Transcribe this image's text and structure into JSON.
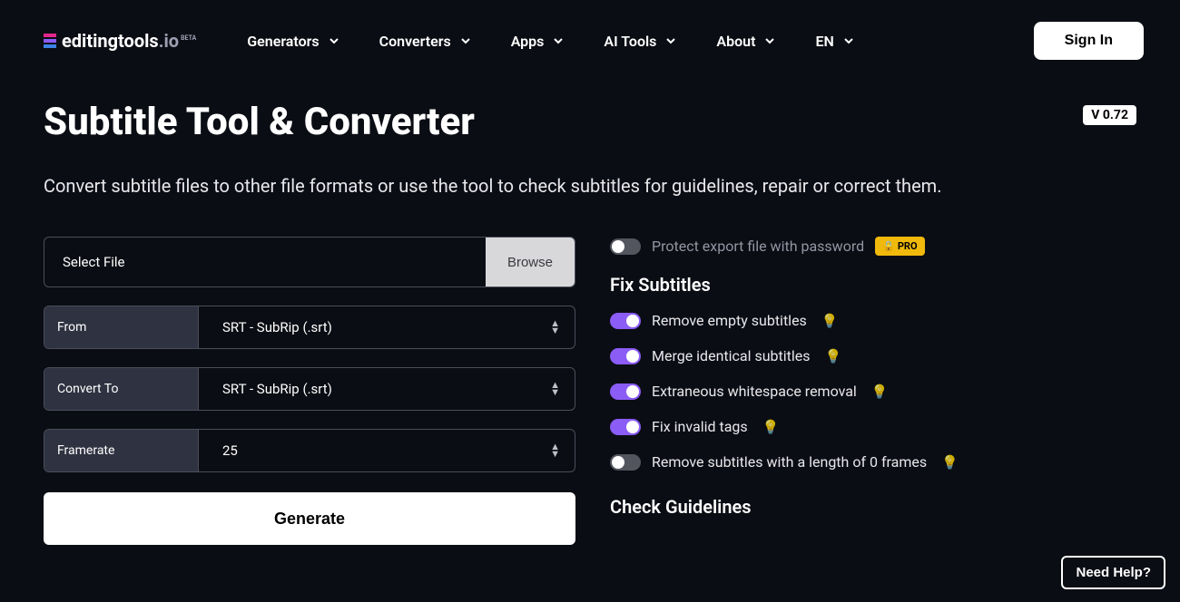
{
  "logo": {
    "text1": "editingtools",
    "text2": ".io",
    "beta": "BETA"
  },
  "nav": {
    "generators": "Generators",
    "converters": "Converters",
    "apps": "Apps",
    "ai_tools": "AI Tools",
    "about": "About",
    "lang": "EN"
  },
  "sign_in": "Sign In",
  "title": "Subtitle Tool & Converter",
  "version": "V 0.72",
  "subtitle": "Convert subtitle files to other file formats or use the tool to check subtitles for guidelines, repair or correct them.",
  "file": {
    "placeholder": "Select File",
    "browse": "Browse"
  },
  "from": {
    "label": "From",
    "value": "SRT - SubRip (.srt)"
  },
  "convert_to": {
    "label": "Convert To",
    "value": "SRT - SubRip (.srt)"
  },
  "framerate": {
    "label": "Framerate",
    "value": "25"
  },
  "generate": "Generate",
  "options": {
    "protect": "Protect export file with password",
    "pro": "PRO",
    "fix_heading": "Fix Subtitles",
    "remove_empty": "Remove empty subtitles",
    "merge_identical": "Merge identical subtitles",
    "whitespace": "Extraneous whitespace removal",
    "invalid_tags": "Fix invalid tags",
    "zero_frames": "Remove subtitles with a length of 0 frames",
    "check_heading": "Check Guidelines"
  },
  "need_help": "Need Help?"
}
